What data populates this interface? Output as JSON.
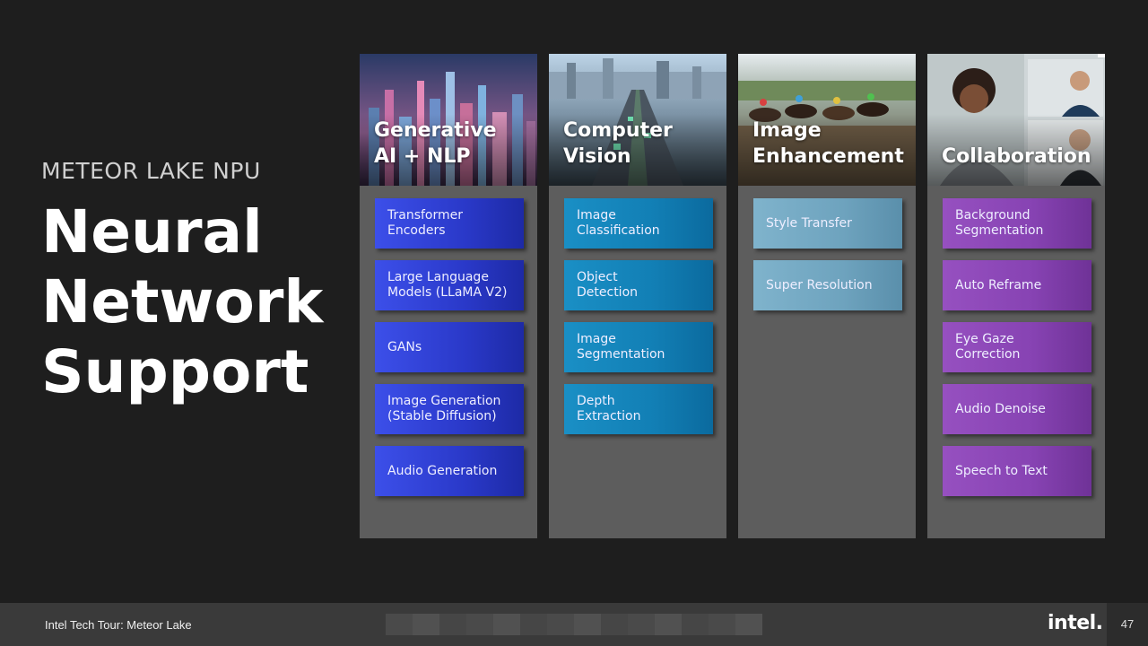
{
  "heading": {
    "subtitle": "METEOR LAKE NPU",
    "title": "Neural Network Support"
  },
  "columns": [
    {
      "title": "Generative\nAI + NLP",
      "image": "city-skyline-neon-image",
      "tile_color": "#2f3fd6",
      "items": [
        "Transformer\nEncoders",
        "Large Language\nModels (LLaMA V2)",
        "GANs",
        "Image Generation\n(Stable Diffusion)",
        "Audio Generation"
      ]
    },
    {
      "title": "Computer\nVision",
      "image": "highway-city-aerial-image",
      "tile_color": "#1583bb",
      "items": [
        "Image\nClassification",
        "Object\nDetection",
        "Image\nSegmentation",
        "Depth\nExtraction"
      ]
    },
    {
      "title": "Image\nEnhancement",
      "image": "horse-race-image",
      "tile_color": "#6fa5c0",
      "items": [
        "Style Transfer",
        "Super Resolution"
      ]
    },
    {
      "title": "Collaboration",
      "image": "video-call-participants-image",
      "tile_color": "#8a45b6",
      "items": [
        "Background\nSegmentation",
        "Auto Reframe",
        "Eye Gaze Correction",
        "Audio Denoise",
        "Speech to Text"
      ]
    }
  ],
  "footer": {
    "text": "Intel Tech Tour: Meteor Lake",
    "logo": "intel.",
    "page": "47"
  }
}
